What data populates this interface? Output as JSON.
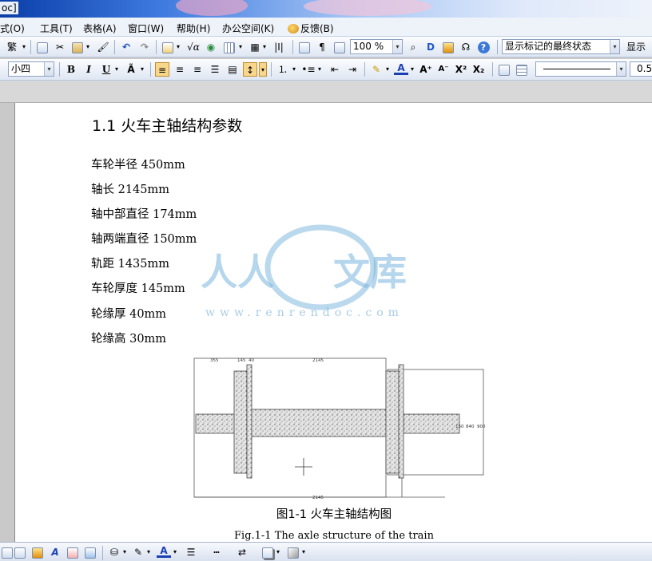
{
  "window": {
    "title": "oc]"
  },
  "menu": [
    {
      "label": "格式(O)",
      "display": "式(O)"
    },
    {
      "label": "工具(T)"
    },
    {
      "label": "表格(A)"
    },
    {
      "label": "窗口(W)"
    },
    {
      "label": "帮助(H)"
    },
    {
      "label": "办公空间(K)"
    },
    {
      "label": "反馈(B)"
    }
  ],
  "toolbar1": {
    "traditional_label": "繁",
    "zoom_value": "100 %",
    "markup_view": "显示标记的最终状态",
    "show_label": "显示"
  },
  "toolbar2": {
    "font_size": "小四",
    "bold": "B",
    "italic": "I",
    "underline": "U",
    "line_style_value": "0.5"
  },
  "document": {
    "heading": "1.1  火车主轴结构参数",
    "params": [
      "车轮半径 450mm",
      "轴长 2145mm",
      "轴中部直径 174mm",
      "轴两端直径 150mm",
      "轨距 1435mm",
      "车轮厚度 145mm",
      "轮缘厚 40mm",
      "轮缘高 30mm"
    ],
    "watermark": {
      "text": "人人文库",
      "url": "www.renrendoc.com"
    },
    "figure": {
      "dims_top": [
        "355",
        "145",
        "40",
        "2145"
      ],
      "dims_right": [
        "150",
        "840",
        "900"
      ],
      "dim_bottom": "2145"
    },
    "caption_cn": "图1-1  火车主轴结构图",
    "caption_en": "Fig.1-1 The axle structure of the train"
  },
  "icons": [
    "new-doc-icon",
    "open-icon",
    "cut-icon",
    "paste-icon",
    "undo-icon",
    "redo-icon",
    "table-icon",
    "formula-icon",
    "globe-icon",
    "find-icon",
    "help-icon",
    "align-left-icon",
    "align-center-icon",
    "align-right-icon",
    "justify-icon",
    "line-spacing-icon",
    "numbering-icon",
    "bullets-icon",
    "highlight-icon",
    "font-color-icon"
  ]
}
